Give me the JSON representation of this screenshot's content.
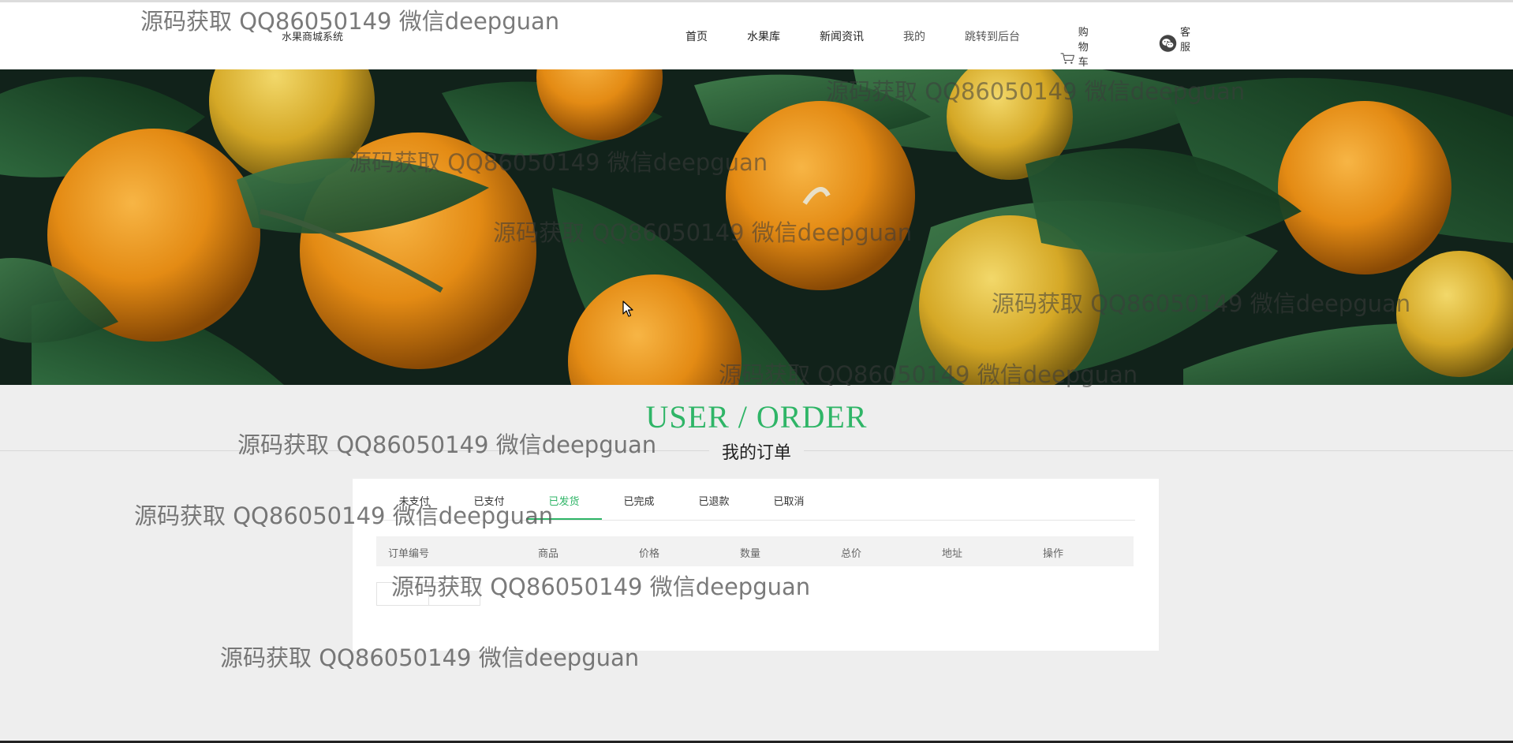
{
  "header": {
    "site_title": "水果商城系统",
    "nav": {
      "home": "首页",
      "fruit_library": "水果库",
      "news": "新闻资讯",
      "mine": "我的",
      "backend": "跳转到后台",
      "cart": "购物车",
      "service": "客服"
    },
    "icons": {
      "cart": "shopping-cart-icon",
      "service": "wechat-icon"
    }
  },
  "section": {
    "title_en": "USER / ORDER",
    "title_cn": "我的订单"
  },
  "orders": {
    "tabs": [
      "未支付",
      "已支付",
      "已发货",
      "已完成",
      "已退款",
      "已取消"
    ],
    "active_tab_index": 2,
    "columns": [
      "订单编号",
      "商品",
      "价格",
      "数量",
      "总价",
      "地址",
      "操作"
    ],
    "rows": []
  },
  "watermark": "源码获取 QQ86050149 微信deepguan",
  "colors": {
    "accent": "#2fb567",
    "background": "#eeeeee",
    "panel": "#ffffff"
  }
}
